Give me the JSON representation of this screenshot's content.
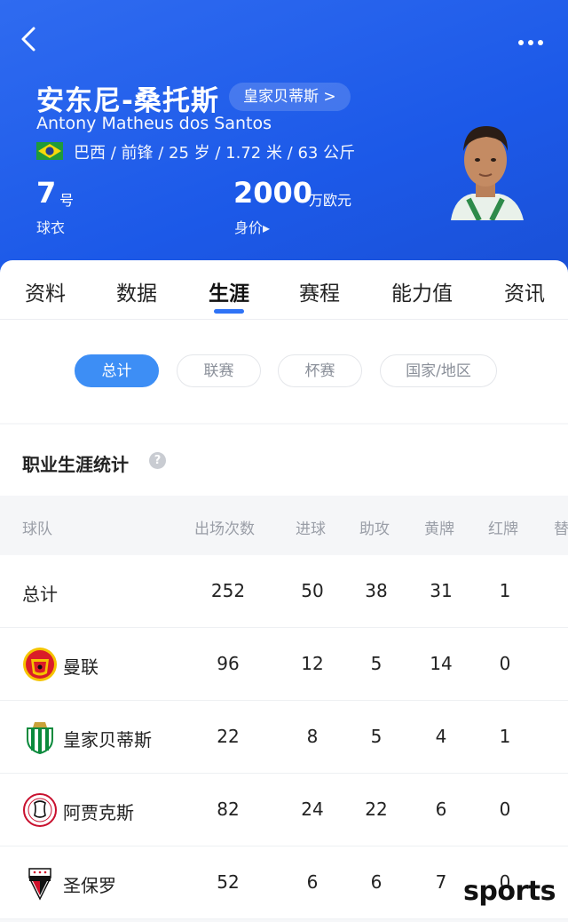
{
  "header": {
    "player_name": "安东尼-桑托斯",
    "club_tag": "皇家贝蒂斯 >",
    "full_name": "Antony Matheus dos Santos",
    "info_line": "巴西 / 前锋 / 25 岁 / 1.72 米 / 63 公斤",
    "shirt_number": "7",
    "shirt_unit": "号",
    "shirt_label": "球衣",
    "market_value": "2000",
    "market_value_unit": "万欧元",
    "market_value_label": "身价▸"
  },
  "tabs": [
    "资料",
    "数据",
    "生涯",
    "赛程",
    "能力值",
    "资讯"
  ],
  "active_tab": "生涯",
  "filters": [
    "总计",
    "联赛",
    "杯赛",
    "国家/地区"
  ],
  "active_filter": "总计",
  "section": {
    "title": "职业生涯统计",
    "help": "?"
  },
  "table": {
    "columns": [
      "球队",
      "出场次数",
      "进球",
      "助攻",
      "黄牌",
      "红牌",
      "替"
    ],
    "rows": [
      {
        "team": "总计",
        "apps": "252",
        "goals": "50",
        "assists": "38",
        "yellow": "31",
        "red": "1"
      },
      {
        "team": "曼联",
        "apps": "96",
        "goals": "12",
        "assists": "5",
        "yellow": "14",
        "red": "0"
      },
      {
        "team": "皇家贝蒂斯",
        "apps": "22",
        "goals": "8",
        "assists": "5",
        "yellow": "4",
        "red": "1"
      },
      {
        "team": "阿贾克斯",
        "apps": "82",
        "goals": "24",
        "assists": "22",
        "yellow": "6",
        "red": "0"
      },
      {
        "team": "圣保罗",
        "apps": "52",
        "goals": "6",
        "assists": "6",
        "yellow": "7",
        "red": "0"
      }
    ]
  },
  "watermark": "sports",
  "colors": {
    "header_blue": "#1c59e8",
    "accent": "#2f73f6",
    "chip_active": "#3d8ef5"
  },
  "icons": [
    "back-arrow-icon",
    "more-dots-icon",
    "brazil-flag-icon",
    "help-icon",
    "man-utd-crest-icon",
    "real-betis-crest-icon",
    "ajax-crest-icon",
    "sao-paulo-crest-icon"
  ]
}
